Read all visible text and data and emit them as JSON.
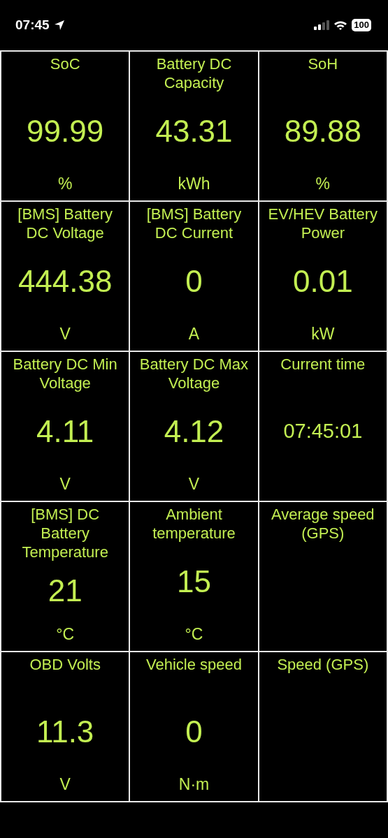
{
  "status_bar": {
    "time": "07:45",
    "battery": "100"
  },
  "cells": [
    {
      "kind": "gauge",
      "title": "SoC",
      "value": "99.99",
      "unit": "%"
    },
    {
      "kind": "gauge",
      "title": "Battery DC Capacity",
      "value": "43.31",
      "unit": "kWh"
    },
    {
      "kind": "gauge",
      "title": "SoH",
      "value": "89.88",
      "unit": "%"
    },
    {
      "kind": "gauge",
      "title": "[BMS] Battery DC Voltage",
      "value": "444.38",
      "unit": "V"
    },
    {
      "kind": "gauge",
      "title": "[BMS] Battery DC Current",
      "value": "0",
      "unit": "A"
    },
    {
      "kind": "gauge",
      "title": "EV/HEV Battery Power",
      "value": "0.01",
      "unit": "kW"
    },
    {
      "kind": "gauge",
      "title": "Battery DC Min Voltage",
      "value": "4.11",
      "unit": "V"
    },
    {
      "kind": "gauge",
      "title": "Battery DC Max Voltage",
      "value": "4.12",
      "unit": "V"
    },
    {
      "kind": "clock",
      "title": "Current time",
      "value": "07:45:01"
    },
    {
      "kind": "gauge",
      "title": "[BMS] DC Battery Temperature",
      "value": "21",
      "unit": "°C"
    },
    {
      "kind": "gauge",
      "title": "Ambient temperature",
      "value": "15",
      "unit": "°C"
    },
    {
      "kind": "gauge",
      "title": "Average speed (GPS)"
    },
    {
      "kind": "gauge",
      "title": "OBD Volts",
      "value": "11.3",
      "unit": "V"
    },
    {
      "kind": "gauge",
      "title": "Vehicle speed",
      "value": "0",
      "unit": "N·m"
    },
    {
      "kind": "gauge",
      "title": "Speed (GPS)"
    }
  ]
}
